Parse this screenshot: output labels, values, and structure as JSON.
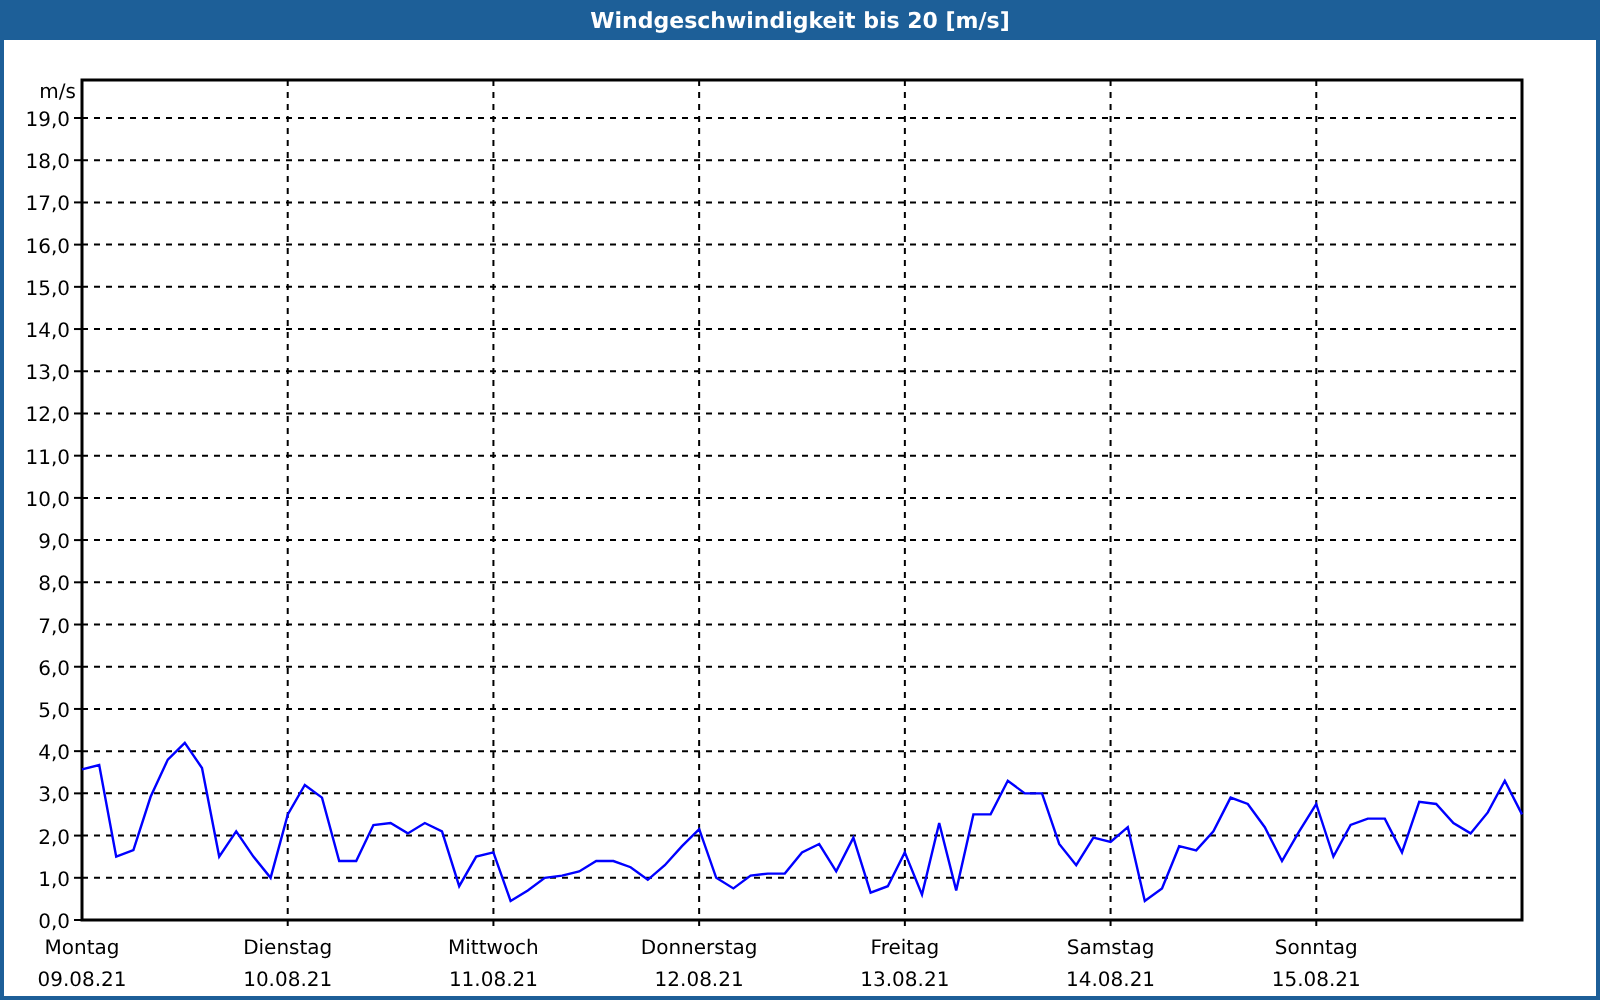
{
  "window": {
    "title": "Windgeschwindigkeit bis 20 [m/s]"
  },
  "chart": {
    "dates": [
      "09.08.21",
      "10.08.21",
      "11.08.21",
      "12.08.21",
      "13.08.21",
      "14.08.21",
      "15.08.21"
    ],
    "chart_data": {
      "type": "line",
      "grid": true,
      "ylabel": "m/s",
      "ylim": [
        0,
        19.9
      ],
      "categories": [
        "Montag",
        null,
        null,
        null,
        null,
        null,
        null,
        null,
        null,
        null,
        null,
        null,
        "Dienstag",
        null,
        null,
        null,
        null,
        null,
        null,
        null,
        null,
        null,
        null,
        null,
        "Mittwoch",
        null,
        null,
        null,
        null,
        null,
        null,
        null,
        null,
        null,
        null,
        null,
        "Donnerstag",
        null,
        null,
        null,
        null,
        null,
        null,
        null,
        null,
        null,
        null,
        null,
        "Freitag",
        null,
        null,
        null,
        null,
        null,
        null,
        null,
        null,
        null,
        null,
        null,
        "Samstag",
        null,
        null,
        null,
        null,
        null,
        null,
        null,
        null,
        null,
        null,
        null,
        "Sonntag",
        null,
        null,
        null,
        null,
        null,
        null,
        null,
        null,
        null,
        null,
        null,
        null
      ],
      "yticks": [
        {
          "value": 0,
          "label": "0,0"
        },
        {
          "value": 1,
          "label": "1,0"
        },
        {
          "value": 2,
          "label": "2,0"
        },
        {
          "value": 3,
          "label": "3,0"
        },
        {
          "value": 4,
          "label": "4,0"
        },
        {
          "value": 5,
          "label": "5,0"
        },
        {
          "value": 6,
          "label": "6,0"
        },
        {
          "value": 7,
          "label": "7,0"
        },
        {
          "value": 8,
          "label": "8,0"
        },
        {
          "value": 9,
          "label": "9,0"
        },
        {
          "value": 10,
          "label": "10,0"
        },
        {
          "value": 11,
          "label": "11,0"
        },
        {
          "value": 12,
          "label": "12,0"
        },
        {
          "value": 13,
          "label": "13,0"
        },
        {
          "value": 14,
          "label": "14,0"
        },
        {
          "value": 15,
          "label": "15,0"
        },
        {
          "value": 16,
          "label": "16,0"
        },
        {
          "value": 17,
          "label": "17,0"
        },
        {
          "value": 18,
          "label": "18,0"
        },
        {
          "value": 19,
          "label": "19,0"
        }
      ],
      "series": [
        {
          "color": "#0000ff",
          "values": [
            3.57,
            3.67,
            1.5,
            1.66,
            2.92,
            3.8,
            4.2,
            3.6,
            1.5,
            2.1,
            1.5,
            1.0,
            2.5,
            3.2,
            2.9,
            1.4,
            1.4,
            2.25,
            2.3,
            2.05,
            2.3,
            2.1,
            0.8,
            1.5,
            1.6,
            0.45,
            0.7,
            1.0,
            1.05,
            1.15,
            1.4,
            1.4,
            1.25,
            0.95,
            1.3,
            1.75,
            2.15,
            1.0,
            0.75,
            1.05,
            1.1,
            1.1,
            1.6,
            1.8,
            1.15,
            1.95,
            0.65,
            0.8,
            1.6,
            0.6,
            2.3,
            0.7,
            2.5,
            2.5,
            3.3,
            3.0,
            3.0,
            1.8,
            1.3,
            1.95,
            1.85,
            2.2,
            0.45,
            0.75,
            1.75,
            1.65,
            2.1,
            2.9,
            2.75,
            2.2,
            1.4,
            2.1,
            2.75,
            1.5,
            2.25,
            2.4,
            2.4,
            1.6,
            2.8,
            2.75,
            2.3,
            2.05,
            2.55,
            3.3,
            2.5
          ]
        }
      ]
    }
  }
}
